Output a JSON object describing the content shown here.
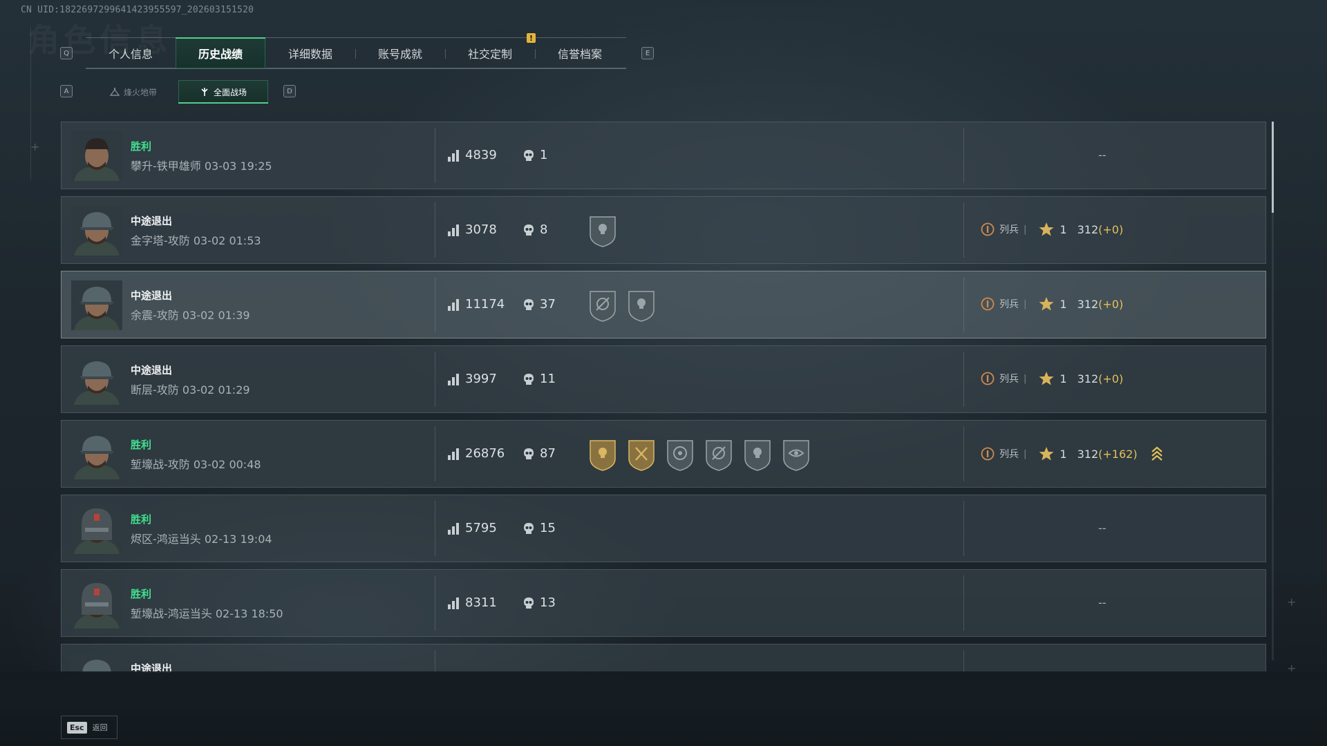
{
  "header": {
    "uid": "CN UID:1822697299641423955597_202603151520",
    "bg_title": "角色信息",
    "tab_key_left": "Q",
    "tab_key_right": "E",
    "notify_badge": "!"
  },
  "tabs": [
    {
      "label": "个人信息",
      "active": false
    },
    {
      "label": "历史战绩",
      "active": true
    },
    {
      "label": "详细数据",
      "active": false
    },
    {
      "label": "账号成就",
      "active": false
    },
    {
      "label": "社交定制",
      "active": false
    },
    {
      "label": "信誉档案",
      "active": false
    }
  ],
  "subtabs": {
    "key_left": "A",
    "key_right": "D",
    "items": [
      {
        "label": "烽火地带",
        "active": false
      },
      {
        "label": "全面战场",
        "active": true
      }
    ]
  },
  "matches": [
    {
      "result": "胜利",
      "win": true,
      "map": "攀升-铁甲雄师 03-03 19:25",
      "score": "4839",
      "kills": "1",
      "medals": [],
      "rank": null,
      "dash": "--",
      "avatar": "soldier",
      "highlight": false
    },
    {
      "result": "中途退出",
      "win": false,
      "map": "金字塔-攻防 03-02 01:53",
      "score": "3078",
      "kills": "8",
      "medals": [
        "skull-medal-icon"
      ],
      "rank": {
        "name": "列兵",
        "sep": "|",
        "level": "1",
        "points": "312",
        "delta": "(+0)",
        "promote": false
      },
      "dash": "",
      "avatar": "cap",
      "highlight": false
    },
    {
      "result": "中途退出",
      "win": false,
      "map": "余震-攻防 03-02 01:39",
      "score": "11174",
      "kills": "37",
      "medals": [
        "crosshair-medal-icon",
        "skull-medal-icon"
      ],
      "rank": {
        "name": "列兵",
        "sep": "|",
        "level": "1",
        "points": "312",
        "delta": "(+0)",
        "promote": false
      },
      "dash": "",
      "avatar": "cap",
      "highlight": true
    },
    {
      "result": "中途退出",
      "win": false,
      "map": "断层-攻防 03-02 01:29",
      "score": "3997",
      "kills": "11",
      "medals": [],
      "rank": {
        "name": "列兵",
        "sep": "|",
        "level": "1",
        "points": "312",
        "delta": "(+0)",
        "promote": false
      },
      "dash": "",
      "avatar": "cap",
      "highlight": false
    },
    {
      "result": "胜利",
      "win": true,
      "map": "堑壕战-攻防 03-02 00:48",
      "score": "26876",
      "kills": "87",
      "medals": [
        "gold-skull-medal-icon",
        "gold-axes-medal-icon",
        "target-medal-icon",
        "crosshair-medal-icon",
        "skull-medal-icon",
        "eye-scope-medal-icon"
      ],
      "rank": {
        "name": "列兵",
        "sep": "|",
        "level": "1",
        "points": "312",
        "delta": "(+162)",
        "promote": true
      },
      "dash": "",
      "avatar": "cap",
      "highlight": false
    },
    {
      "result": "胜利",
      "win": true,
      "map": "烬区-鸿运当头 02-13 19:04",
      "score": "5795",
      "kills": "15",
      "medals": [],
      "rank": null,
      "dash": "--",
      "avatar": "mask",
      "highlight": false
    },
    {
      "result": "胜利",
      "win": true,
      "map": "堑壕战-鸿运当头 02-13 18:50",
      "score": "8311",
      "kills": "13",
      "medals": [],
      "rank": null,
      "dash": "--",
      "avatar": "mask",
      "highlight": false
    },
    {
      "result": "中途退出",
      "win": false,
      "map": "",
      "score": "",
      "kills": "",
      "medals": [],
      "rank": null,
      "dash": "",
      "avatar": "cap",
      "highlight": false
    }
  ],
  "footer": {
    "esc_key": "Esc",
    "back_label": "返回"
  },
  "colors": {
    "win": "#42e08f",
    "accent": "#4fd08e",
    "gold": "#e3c15a"
  }
}
